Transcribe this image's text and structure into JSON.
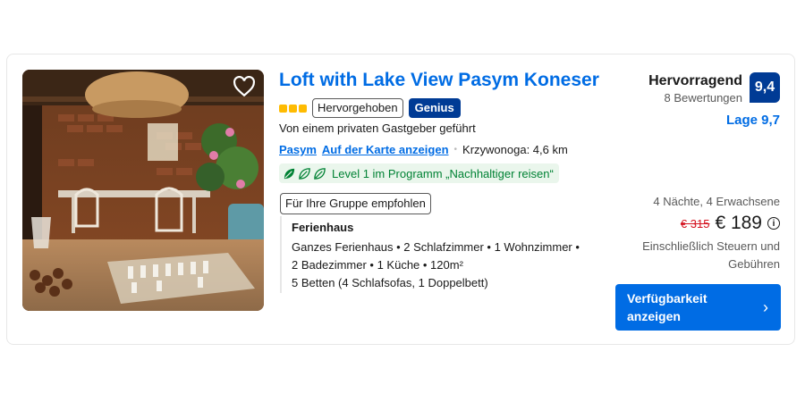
{
  "listing": {
    "title": "Loft with Lake View Pasym Koneser",
    "star_rating_count": 3,
    "badge_highlighted": "Hervorgehoben",
    "badge_genius": "Genius",
    "host_text": "Von einem privaten Gastgeber geführt",
    "location_link": "Pasym",
    "map_link": "Auf der Karte anzeigen",
    "distance": "Krzywonoga: 4,6 km",
    "sustainability": "Level 1 im Programm „Nachhaltiger reisen“",
    "group_badge": "Für Ihre Gruppe empfohlen",
    "unit_type": "Ferienhaus",
    "unit_lines": [
      "Ganzes Ferienhaus • 2 Schlafzimmer • 1 Wohnzimmer •",
      "2 Badezimmer • 1 Küche • 120m²",
      "5 Betten (4 Schlafsofas, 1 Doppelbett)"
    ]
  },
  "review": {
    "word": "Hervorragend",
    "count": "8 Bewertungen",
    "score": "9,4",
    "location_score": "Lage 9,7"
  },
  "pricing": {
    "stay": "4 Nächte, 4 Erwachsene",
    "old_price": "€ 315",
    "price": "€ 189",
    "taxes": "Einschließlich Steuern und Gebühren"
  },
  "cta": {
    "label": "Verfügbarkeit anzeigen"
  },
  "icons": {
    "favorite": "heart-icon",
    "info": "info-icon",
    "leaf": "leaf-icon",
    "chevron": "chevron-right-icon"
  },
  "colors": {
    "brand_blue": "#006ce4",
    "dark_blue": "#003b95",
    "star_yellow": "#febb02",
    "sustain_green": "#008234",
    "price_red": "#d4111e"
  }
}
